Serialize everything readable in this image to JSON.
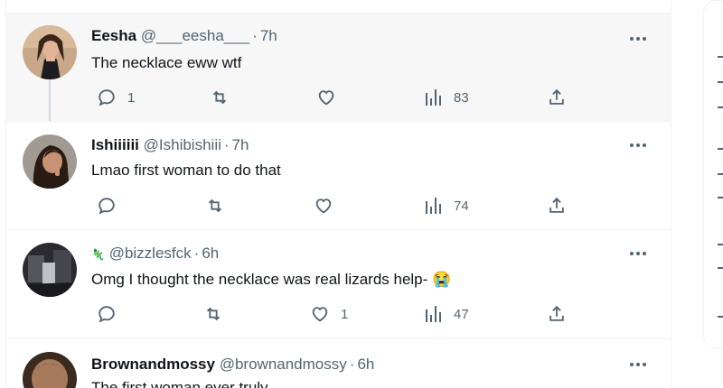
{
  "tweets": [
    {
      "name": "Eesha",
      "handle": "@___eesha___",
      "dot": "·",
      "time": "7h",
      "text": "The necklace eww wtf",
      "reply_count": "1",
      "retweet_count": "",
      "like_count": "",
      "view_count": "83"
    },
    {
      "name": "Ishiiiiii",
      "handle": "@Ishibishiii",
      "dot": "·",
      "time": "7h",
      "text": "Lmao first woman to do that",
      "reply_count": "",
      "retweet_count": "",
      "like_count": "",
      "view_count": "74"
    },
    {
      "name": "",
      "name_emoji": "🦎",
      "handle": "@bizzlesfck",
      "dot": "·",
      "time": "6h",
      "text": "Omg I thought the necklace was real lizards help-",
      "text_emoji": "😭",
      "reply_count": "",
      "retweet_count": "",
      "like_count": "1",
      "view_count": "47"
    },
    {
      "name": "Brownandmossy",
      "handle": "@brownandmossy",
      "dot": "·",
      "time": "6h",
      "text": "The first woman ever truly"
    }
  ],
  "colors": {
    "text": "#0f1419",
    "secondary": "#536471",
    "border": "#eff3f4",
    "highlight": "#f7f7f7",
    "thread": "#cfd9de"
  },
  "icons": {
    "reply": "reply-icon",
    "retweet": "retweet-icon",
    "like": "like-icon",
    "views": "views-icon",
    "share": "share-icon",
    "more": "more-icon"
  }
}
